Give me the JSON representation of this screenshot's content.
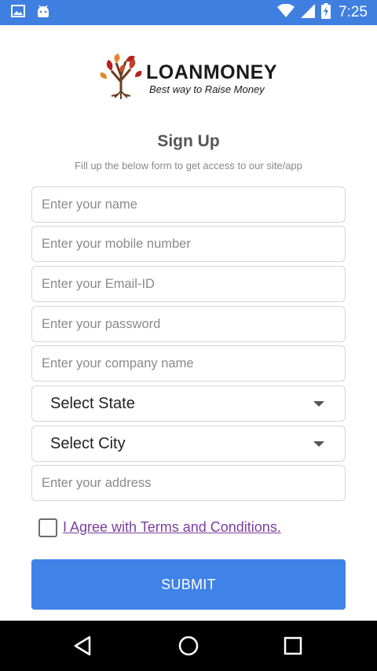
{
  "status_bar": {
    "time": "7:25",
    "icons": [
      "image-icon",
      "android-icon",
      "wifi-icon",
      "signal-icon",
      "battery-charging-icon"
    ]
  },
  "logo": {
    "title": "LOANMONEY",
    "tagline": "Best way to Raise Money"
  },
  "page": {
    "title": "Sign Up",
    "subtitle": "Fill up the below form to get access to our site/app"
  },
  "form": {
    "name_placeholder": "Enter your name",
    "mobile_placeholder": "Enter your mobile number",
    "email_placeholder": "Enter your Email-ID",
    "password_placeholder": "Enter your password",
    "company_placeholder": "Enter your company name",
    "state_select": "Select State",
    "city_select": "Select City",
    "address_placeholder": "Enter your address",
    "terms_label": "I Agree with Terms and Conditions.",
    "submit_label": "SUBMIT"
  },
  "colors": {
    "primary": "#3f82e8",
    "status_bar": "#3f7fe0",
    "link": "#7b3fa0"
  },
  "nav_bar": {
    "icons": [
      "back-icon",
      "home-icon",
      "recents-icon"
    ]
  }
}
